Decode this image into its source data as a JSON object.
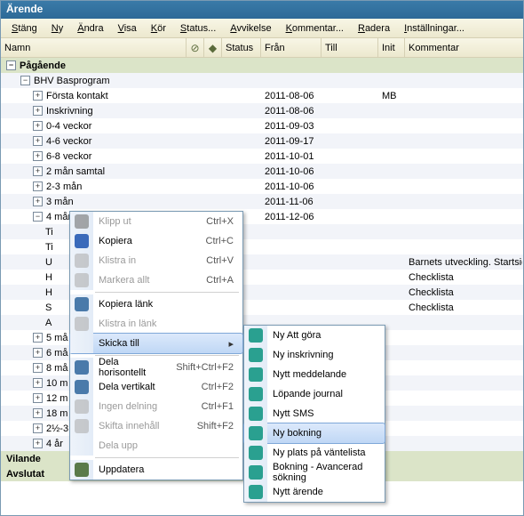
{
  "window": {
    "title": "Ärende"
  },
  "menubar": [
    "Stäng",
    "Ny",
    "Ändra",
    "Visa",
    "Kör",
    "Status...",
    "Avvikelse",
    "Kommentar...",
    "Radera",
    "Inställningar..."
  ],
  "columns": [
    "Namn",
    "Status",
    "Från",
    "Till",
    "Init",
    "Kommentar"
  ],
  "sections": {
    "pagaende": "Pågående",
    "vilande": "Vilande",
    "avslutat": "Avslutat"
  },
  "tree": {
    "root": {
      "label": "BHV Basprogram"
    },
    "children": [
      {
        "label": "Första kontakt",
        "from": "2011-08-06",
        "init": "MB",
        "expand": "plus"
      },
      {
        "label": "Inskrivning",
        "from": "2011-08-06",
        "expand": "plus"
      },
      {
        "label": "0-4 veckor",
        "from": "2011-09-03",
        "expand": "plus"
      },
      {
        "label": "4-6 veckor",
        "from": "2011-09-17",
        "expand": "plus"
      },
      {
        "label": "6-8 veckor",
        "from": "2011-10-01",
        "expand": "plus"
      },
      {
        "label": "2 mån samtal",
        "from": "2011-10-06",
        "expand": "plus"
      },
      {
        "label": "2-3 mån",
        "from": "2011-10-06",
        "expand": "plus"
      },
      {
        "label": "3 mån",
        "from": "2011-11-06",
        "expand": "plus"
      },
      {
        "label": "4 mån",
        "from": "2011-12-06",
        "expand": "minus"
      }
    ],
    "fourman_children": [
      {
        "label": "Ti"
      },
      {
        "label": "Ti"
      },
      {
        "label": "U",
        "komm": "Barnets utveckling. Startsida"
      },
      {
        "label": "H",
        "komm": "Checklista"
      },
      {
        "label": "H",
        "komm": "Checklista"
      },
      {
        "label": "S",
        "komm": "Checklista"
      },
      {
        "label": "A"
      }
    ],
    "after": [
      {
        "label": "5 må",
        "expand": "plus"
      },
      {
        "label": "6 må",
        "expand": "plus"
      },
      {
        "label": "8 må",
        "expand": "plus"
      },
      {
        "label": "10 m",
        "expand": "plus"
      },
      {
        "label": "12 m",
        "expand": "plus"
      },
      {
        "label": "18 m",
        "expand": "plus"
      },
      {
        "label": "2½-3",
        "expand": "plus"
      },
      {
        "label": "4 år",
        "expand": "plus"
      }
    ]
  },
  "context_menu": [
    {
      "label": "Klipp ut",
      "shortcut": "Ctrl+X",
      "icon": "g-cut",
      "disabled": true
    },
    {
      "label": "Kopiera",
      "shortcut": "Ctrl+C",
      "icon": "g-copy"
    },
    {
      "label": "Klistra in",
      "shortcut": "Ctrl+V",
      "icon": "g-paste",
      "disabled": true
    },
    {
      "label": "Markera allt",
      "shortcut": "Ctrl+A",
      "icon": "g-sel",
      "disabled": true
    },
    {
      "sep": true
    },
    {
      "label": "Kopiera länk",
      "icon": "g-link"
    },
    {
      "label": "Klistra in länk",
      "icon": "g-plink",
      "disabled": true
    },
    {
      "label": "Skicka till",
      "submenu": true,
      "highlight": true
    },
    {
      "sep": true
    },
    {
      "label": "Dela horisontellt",
      "shortcut": "Shift+Ctrl+F2",
      "icon": "g-split"
    },
    {
      "label": "Dela vertikalt",
      "shortcut": "Ctrl+F2",
      "icon": "g-split"
    },
    {
      "label": "Ingen delning",
      "shortcut": "Ctrl+F1",
      "icon": "g-nosplit",
      "disabled": true
    },
    {
      "label": "Skifta innehåll",
      "shortcut": "Shift+F2",
      "icon": "g-swap",
      "disabled": true
    },
    {
      "label": "Dela upp",
      "disabled": true
    },
    {
      "sep": true
    },
    {
      "label": "Uppdatera",
      "icon": "g-undo"
    }
  ],
  "submenu": [
    {
      "label": "Ny Att göra"
    },
    {
      "label": "Ny inskrivning"
    },
    {
      "label": "Nytt meddelande"
    },
    {
      "label": "Löpande journal"
    },
    {
      "label": "Nytt SMS"
    },
    {
      "label": "Ny bokning",
      "highlight": true
    },
    {
      "label": "Ny plats på väntelista"
    },
    {
      "label": "Bokning - Avancerad sökning"
    },
    {
      "label": "Nytt ärende"
    }
  ]
}
